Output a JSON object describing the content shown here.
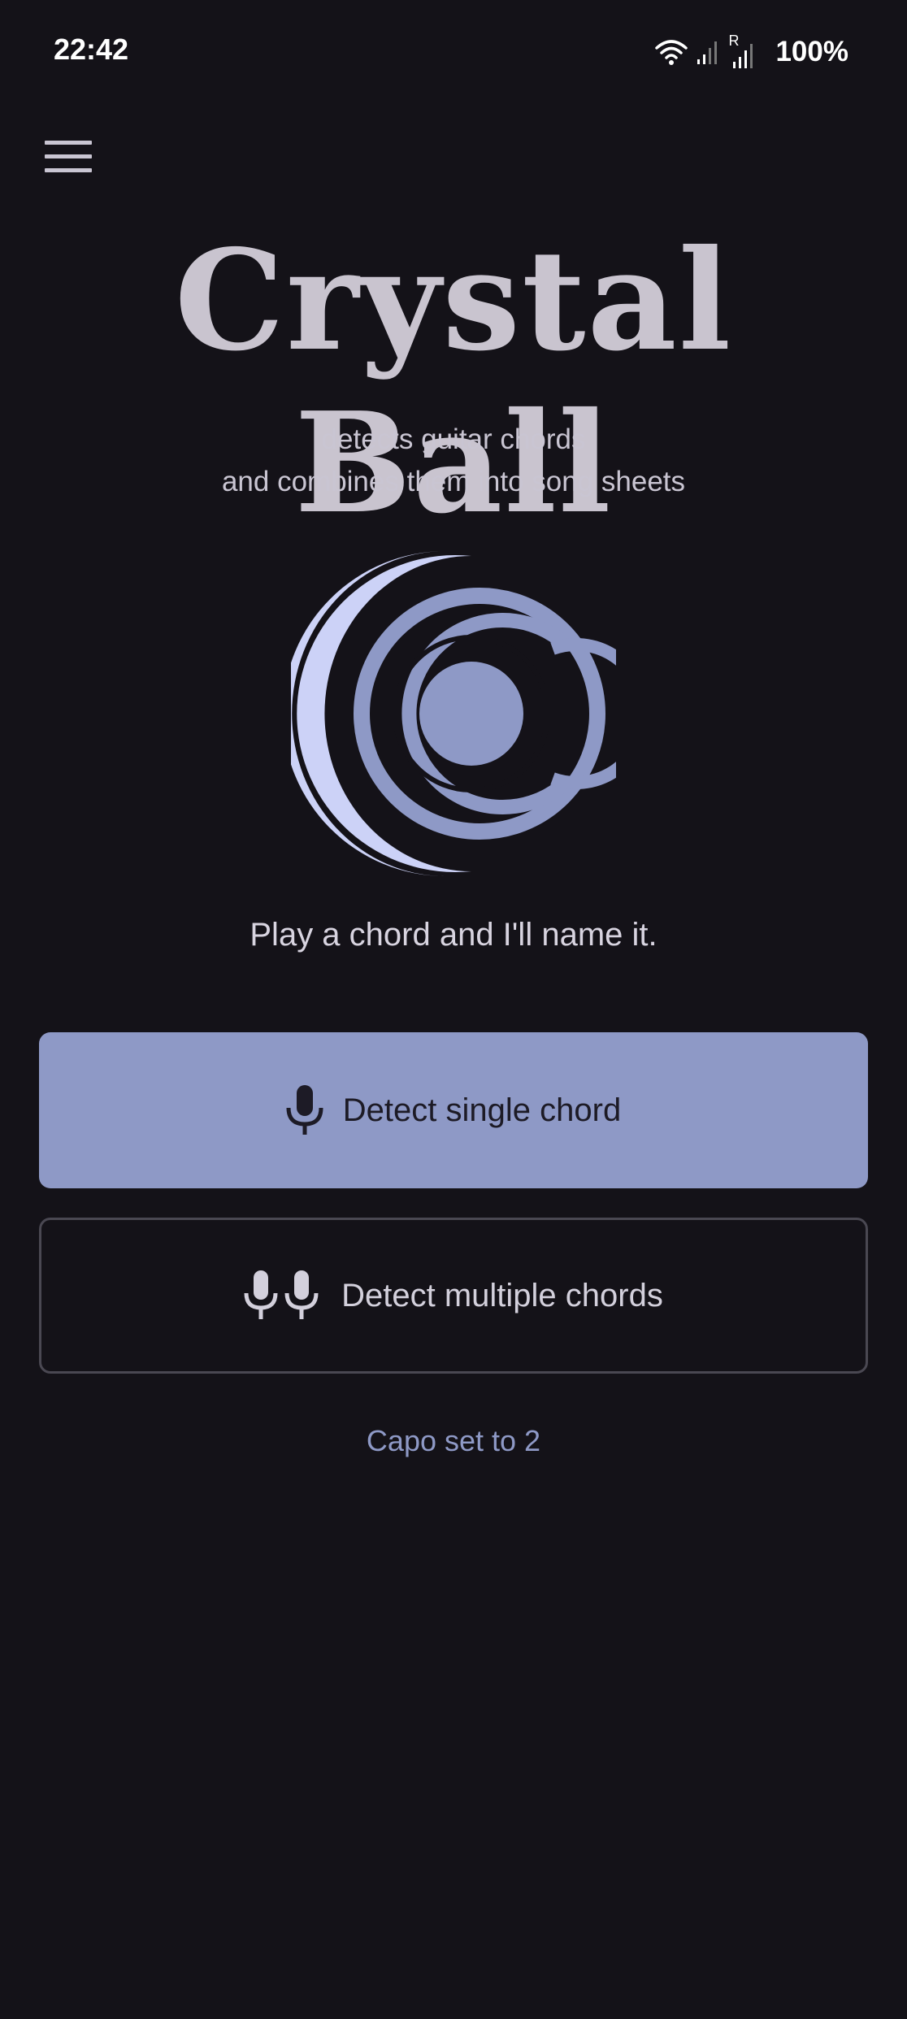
{
  "status_bar": {
    "time": "22:42",
    "battery": "100%",
    "icons": [
      "wifi-icon",
      "signal-icon",
      "roaming-signal-icon"
    ],
    "roaming_letter": "R"
  },
  "menu": {
    "icon": "hamburger-menu-icon"
  },
  "app": {
    "title": "Crystal Ball",
    "subtitle_line1": "detects guitar chords",
    "subtitle_line2": "and combines them into song sheets",
    "logo_icon": "crystal-ball-logo",
    "prompt": "Play a chord and I'll name it."
  },
  "actions": {
    "single": {
      "label": "Detect single chord",
      "icon": "microphone-icon"
    },
    "multiple": {
      "label": "Detect multiple chords",
      "icon": "double-microphone-icon"
    }
  },
  "capo": {
    "label": "Capo set to 2"
  },
  "colors": {
    "background": "#141218",
    "accent": "#8e99c6",
    "accent_light": "#ccd2f7",
    "text": "#c9c5d2",
    "outline": "#4a4852"
  }
}
